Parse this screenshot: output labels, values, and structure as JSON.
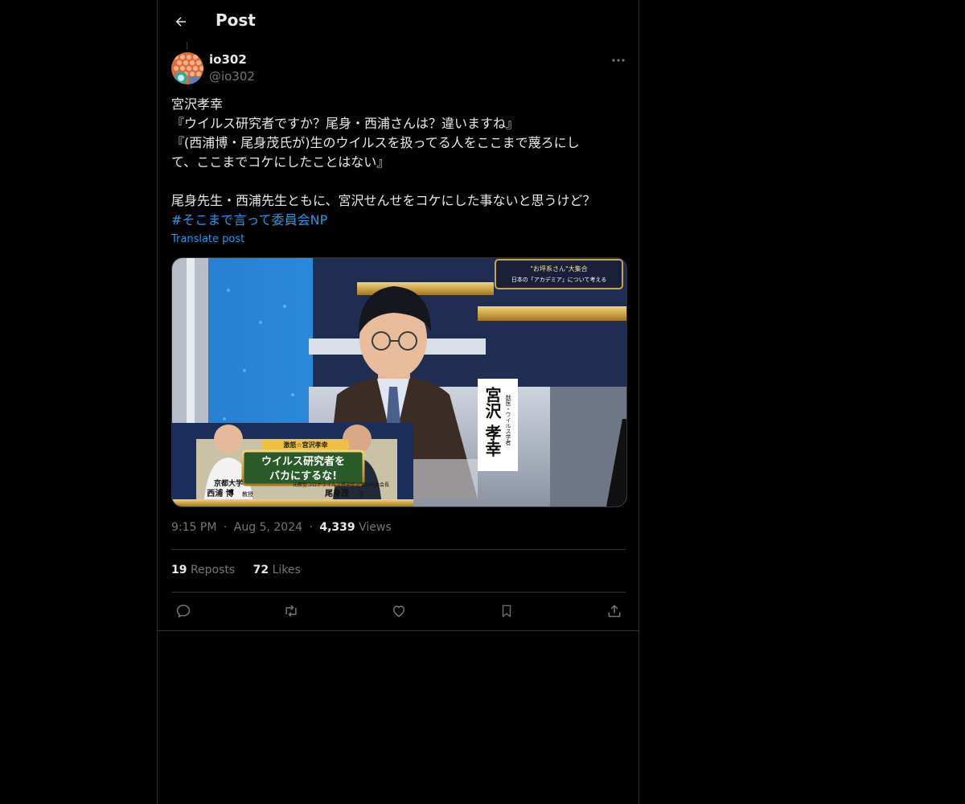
{
  "header": {
    "title": "Post"
  },
  "author": {
    "name": "io302",
    "handle": "@io302"
  },
  "post": {
    "lines": [
      "宮沢孝幸",
      "『ウイルス研究者ですか？尾身・西浦さんは？違いますね』",
      "『(西浦博・尾身茂氏が)生のウイルスを扱ってる人をここまで蔑ろにし",
      "て、ここまでコケにしたことはない』",
      "",
      "尾身先生・西浦先生ともに、宮沢せんせをコケにした事ないと思うけど？"
    ],
    "hashtag": "#そこまで言って委員会NP",
    "translate": "Translate post"
  },
  "media": {
    "top_banner_line1": "\"お坪系さん\"大集合",
    "top_banner_line2": "日本の「アカデミア」について考える",
    "name_tag_sub": "獣医・ウイルス学者",
    "name_tag_main": "宮沢 孝幸",
    "lower_tag_top": "激怒☆宮沢孝幸",
    "lower_title_1": "ウイルス研究者を",
    "lower_title_2": "バカにするな!",
    "left_person_affil": "京都大学",
    "left_person_name": "西浦 博",
    "left_person_role": "教授",
    "right_person_affil": "元新型コロナウイルス感染症対策分科会会長",
    "right_person_name": "尾身茂",
    "right_person_role": "氏"
  },
  "meta": {
    "time": "9:15 PM",
    "sep1": "·",
    "date": "Aug 5, 2024",
    "sep2": "·",
    "views": "4,339",
    "views_label": "Views"
  },
  "stats": {
    "reposts": "19",
    "reposts_label": "Reposts",
    "likes": "72",
    "likes_label": "Likes"
  },
  "icons": {
    "back": "arrow-left-icon",
    "more": "more-horizontal-icon",
    "reply": "reply-icon",
    "repost": "repost-icon",
    "like": "heart-icon",
    "bookmark": "bookmark-icon",
    "share": "share-icon"
  },
  "colors": {
    "accent": "#1d9bf0",
    "muted": "#71767b",
    "text": "#e7e9ea",
    "border": "#2f3336"
  }
}
